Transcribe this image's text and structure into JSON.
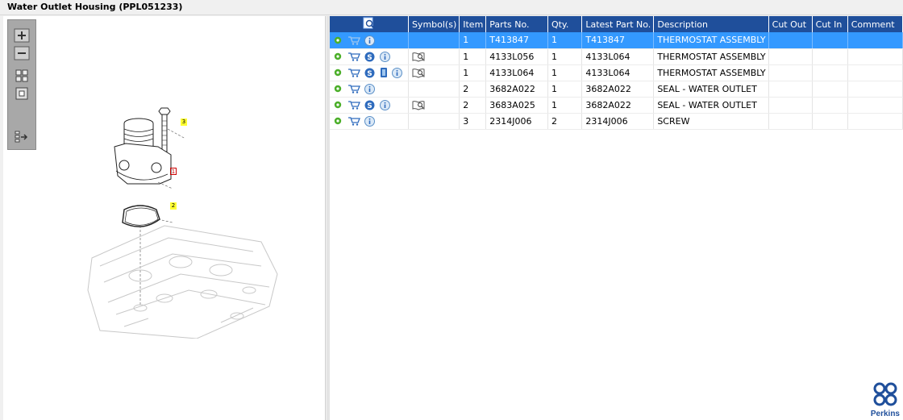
{
  "window": {
    "title": "Water Outlet Housing (PPL051233)"
  },
  "toolbar": {
    "zoom_in": "zoom-in",
    "zoom_out": "zoom-out",
    "fit": "fit-all",
    "actual": "actual-size",
    "layout": "toggle-layout"
  },
  "drawing": {
    "callouts": [
      "3",
      "1",
      "2"
    ]
  },
  "table": {
    "headers": {
      "symbols": "Symbol(s)",
      "item": "Item",
      "parts_no": "Parts No.",
      "qty": "Qty.",
      "latest": "Latest Part No.",
      "description": "Description",
      "cut_out": "Cut Out",
      "cut_in": "Cut In",
      "comment": "Comment"
    },
    "rows": [
      {
        "item": "1",
        "parts_no": "T413847",
        "qty": "1",
        "latest": "T413847",
        "description": "THERMOSTAT ASSEMBLY",
        "cut_out": "",
        "cut_in": "",
        "comment": ""
      },
      {
        "item": "1",
        "parts_no": "4133L056",
        "qty": "1",
        "latest": "4133L064",
        "description": "THERMOSTAT ASSEMBLY",
        "cut_out": "",
        "cut_in": "",
        "comment": ""
      },
      {
        "item": "1",
        "parts_no": "4133L064",
        "qty": "1",
        "latest": "4133L064",
        "description": "THERMOSTAT ASSEMBLY",
        "cut_out": "",
        "cut_in": "",
        "comment": ""
      },
      {
        "item": "2",
        "parts_no": "3682A022",
        "qty": "1",
        "latest": "3682A022",
        "description": "SEAL - WATER OUTLET",
        "cut_out": "",
        "cut_in": "",
        "comment": ""
      },
      {
        "item": "2",
        "parts_no": "3683A025",
        "qty": "1",
        "latest": "3682A022",
        "description": "SEAL - WATER OUTLET",
        "cut_out": "",
        "cut_in": "",
        "comment": ""
      },
      {
        "item": "3",
        "parts_no": "2314J006",
        "qty": "2",
        "latest": "2314J006",
        "description": "SCREW",
        "cut_out": "",
        "cut_in": "",
        "comment": ""
      }
    ]
  },
  "logo": {
    "text": "Perkins"
  },
  "colors": {
    "header": "#1f4f9b",
    "selected": "#3399ff",
    "gear": "#4caf2a",
    "cart": "#2e6bbd"
  }
}
